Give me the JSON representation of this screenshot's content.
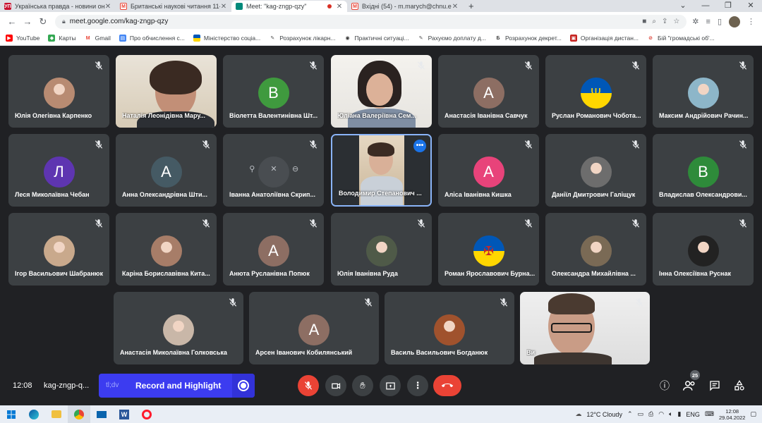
{
  "browser": {
    "tabs": [
      {
        "title": "Українська правда - новини он",
        "favicon_text": "УП",
        "favicon_color": "#c8102e",
        "active": false
      },
      {
        "title": "Британські наукові читання 11-",
        "favicon_text": "M",
        "favicon_color": "#ea4335",
        "active": false
      },
      {
        "title": "Meet: \"kag-zngp-qzy\"",
        "favicon_text": "",
        "favicon_color": "#00897b",
        "active": true,
        "recording": true
      },
      {
        "title": "Вхідні (54) - m.marych@chnu.ed",
        "favicon_text": "M",
        "favicon_color": "#ea4335",
        "active": false
      }
    ],
    "url": "meet.google.com/kag-zngp-qzy",
    "bookmarks": [
      {
        "label": "YouTube",
        "color": "#ff0000",
        "glyph": "▶"
      },
      {
        "label": "Карты",
        "color": "#34a853",
        "glyph": "◆"
      },
      {
        "label": "Gmail",
        "color": "#ea4335",
        "glyph": "M"
      },
      {
        "label": "Про обчислення с...",
        "color": "#4285f4",
        "glyph": "▤"
      },
      {
        "label": "Міністерство соціа...",
        "color": "#f4c20d",
        "glyph": "▬"
      },
      {
        "label": "Розрахунок лікарн...",
        "color": "#555555",
        "glyph": "✎"
      },
      {
        "label": "Практичні ситуаці...",
        "color": "#333333",
        "glyph": "◉"
      },
      {
        "label": "Рахуємо доплату д...",
        "color": "#555555",
        "glyph": "✎"
      },
      {
        "label": "Розрахунок декрет...",
        "color": "#444444",
        "glyph": "Б"
      },
      {
        "label": "Організація дистан...",
        "color": "#c5221f",
        "glyph": "▣"
      },
      {
        "label": "Бій \"громадські об'...",
        "color": "#d93025",
        "glyph": "⊘"
      }
    ]
  },
  "meet": {
    "tiles": [
      {
        "name": "Юлія Олегівна Карпенко",
        "type": "photo",
        "color": "#b88b72",
        "muted": true
      },
      {
        "name": "Наталія Леонідівна Мару...",
        "type": "video",
        "video": "woman1",
        "muted": false
      },
      {
        "name": "Віолетта Валентинівна Шт...",
        "type": "letter",
        "letter": "В",
        "color": "#3f9a3e",
        "muted": true
      },
      {
        "name": "Юліана Валеріївна Сем...",
        "type": "video",
        "video": "woman2",
        "muted": true
      },
      {
        "name": "Анастасія Іванівна Савчук",
        "type": "letter",
        "letter": "А",
        "color": "#8d6e63",
        "muted": true
      },
      {
        "name": "Руслан Романович Чобота...",
        "type": "flag",
        "muted": true
      },
      {
        "name": "Максим Андрійович Рачин...",
        "type": "photo",
        "color": "#8db6c9",
        "muted": true
      },
      {
        "name": "Леся Миколаївна Чебан",
        "type": "letter",
        "letter": "Л",
        "color": "#5e35b1",
        "muted": true
      },
      {
        "name": "Анна Олександрівна Шти...",
        "type": "letter",
        "letter": "А",
        "color": "#455a64",
        "muted": true
      },
      {
        "name": "Іванна Анатоліївна Скрип...",
        "type": "hover",
        "color": "#555a60",
        "muted": true
      },
      {
        "name": "Володимир Степанович ...",
        "type": "video",
        "video": "man1",
        "muted": false,
        "selected": true
      },
      {
        "name": "Аліса Іванівна Кишка",
        "type": "letter",
        "letter": "А",
        "color": "#e8437a",
        "muted": true
      },
      {
        "name": "Даніїл Дмитрович Галіщук",
        "type": "photo",
        "color": "#6d6d6d",
        "muted": true
      },
      {
        "name": "Владислав Олександрови...",
        "type": "letter",
        "letter": "В",
        "color": "#2e8b3a",
        "muted": true
      },
      {
        "name": "Ігор Васильович Шабранюк",
        "type": "photo",
        "color": "#c9a98c",
        "muted": true
      },
      {
        "name": "Каріна Бориславівна Кита...",
        "type": "photo",
        "color": "#a77d68",
        "muted": true
      },
      {
        "name": "Анюта Русланівна Попюк",
        "type": "letter",
        "letter": "А",
        "color": "#8d6e63",
        "muted": true
      },
      {
        "name": "Юлія Іванівна Руда",
        "type": "photo",
        "color": "#4f5a48",
        "muted": true
      },
      {
        "name": "Роман Ярославович Бурна...",
        "type": "flag2",
        "muted": true
      },
      {
        "name": "Олександра Михайлівна ...",
        "type": "photo",
        "color": "#7a6a55",
        "muted": true
      },
      {
        "name": "Інна Олексіївна Руснак",
        "type": "photo",
        "color": "#222222",
        "muted": true
      },
      {
        "name": "Анастасія Миколаївна Голковська",
        "type": "photo",
        "color": "#c9b7a8",
        "muted": true
      },
      {
        "name": "Арсен Іванович Кобилянський",
        "type": "letter",
        "letter": "А",
        "color": "#8d6e63",
        "muted": true
      },
      {
        "name": "Василь Васильович Богданюк",
        "type": "photo",
        "color": "#a0522d",
        "muted": true
      },
      {
        "name": "Ви",
        "type": "video",
        "video": "me",
        "muted": true
      }
    ],
    "bottom": {
      "time": "12:08",
      "meeting_code": "kag-zngp-q...",
      "tldv_label": "tl;dv",
      "record_label": "Record and Highlight",
      "participants_count": "25"
    }
  },
  "taskbar": {
    "weather": "12°C  Cloudy",
    "lang": "ENG",
    "time": "12:08",
    "date": "29.04.2022"
  },
  "colors": {
    "meet_bg": "#202124",
    "tile_bg": "#3c4043",
    "record_btn": "#3c3cf0",
    "end_call": "#ea4335"
  }
}
